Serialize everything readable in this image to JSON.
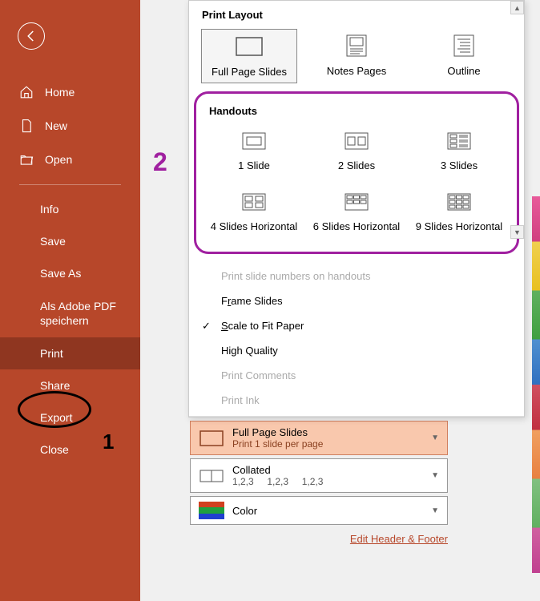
{
  "sidebar": {
    "top": [
      {
        "icon": "home-icon",
        "label": "Home"
      },
      {
        "icon": "new-icon",
        "label": "New"
      },
      {
        "icon": "open-icon",
        "label": "Open"
      }
    ],
    "bottom": [
      {
        "label": "Info",
        "active": false
      },
      {
        "label": "Save",
        "active": false
      },
      {
        "label": "Save As",
        "active": false
      },
      {
        "label": "Als Adobe PDF speichern",
        "active": false
      },
      {
        "label": "Print",
        "active": true
      },
      {
        "label": "Share",
        "active": false
      },
      {
        "label": "Export",
        "active": false
      },
      {
        "label": "Close",
        "active": false
      }
    ]
  },
  "annotations": {
    "one": "1",
    "two": "2"
  },
  "panel": {
    "section1_title": "Print Layout",
    "layout": [
      {
        "label": "Full Page Slides",
        "selected": true
      },
      {
        "label": "Notes Pages",
        "selected": false
      },
      {
        "label": "Outline",
        "selected": false
      }
    ],
    "section2_title": "Handouts",
    "handouts_row1": [
      {
        "label": "1 Slide"
      },
      {
        "label": "2 Slides"
      },
      {
        "label": "3 Slides"
      }
    ],
    "handouts_row2": [
      {
        "label": "4 Slides Horizontal"
      },
      {
        "label": "6 Slides Horizontal"
      },
      {
        "label": "9 Slides Horizontal"
      }
    ],
    "menu": {
      "print_numbers": "Print slide numbers on handouts",
      "frame_slides_pre": "F",
      "frame_slides_u": "r",
      "frame_slides_post": "ame Slides",
      "scale_pre": "",
      "scale_u": "S",
      "scale_post": "cale to Fit Paper",
      "high_quality": "High Quality",
      "print_comments": "Print Comments",
      "print_ink": "Print Ink"
    }
  },
  "settings": {
    "layout": {
      "title": "Full Page Slides",
      "sub": "Print 1 slide per page"
    },
    "collate": {
      "title": "Collated",
      "sub": "1,2,3     1,2,3     1,2,3"
    },
    "color": {
      "title": "Color"
    },
    "edit_link": "Edit Header & Footer"
  }
}
